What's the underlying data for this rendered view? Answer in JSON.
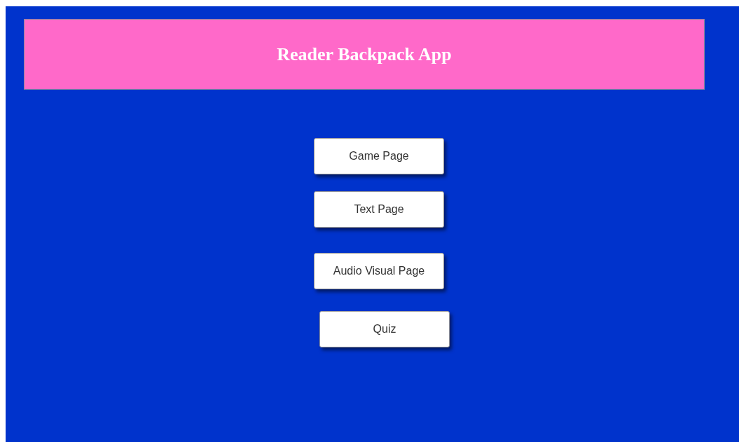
{
  "header": {
    "title": "Reader Backpack App"
  },
  "buttons": [
    {
      "label": "Game Page"
    },
    {
      "label": "Text Page"
    },
    {
      "label": "Audio Visual Page"
    },
    {
      "label": "Quiz"
    }
  ]
}
